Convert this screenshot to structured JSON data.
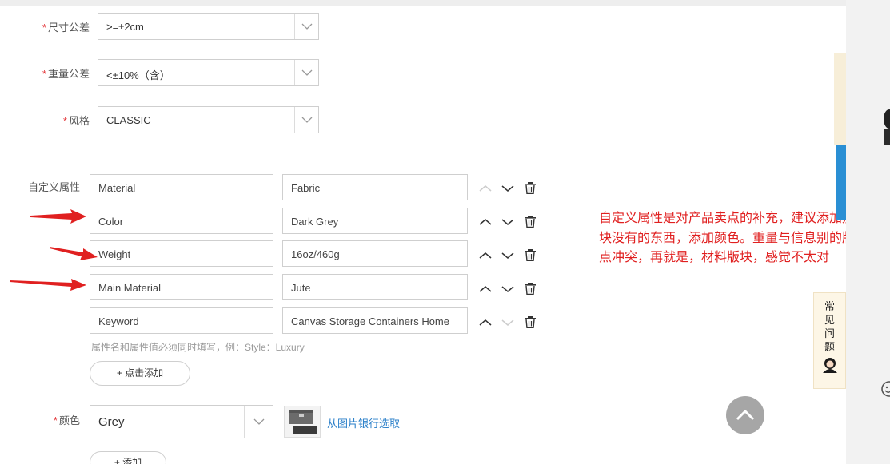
{
  "form": {
    "size_tolerance": {
      "label": "尺寸公差",
      "required": "*",
      "value": ">=±2cm"
    },
    "weight_tolerance": {
      "label": "重量公差",
      "required": "*",
      "value": "<±10%（含）"
    },
    "style": {
      "label": "风格",
      "required": "*",
      "value": "CLASSIC"
    },
    "custom_attrs": {
      "label": "自定义属性",
      "rows": [
        {
          "name": "Material",
          "value": "Fabric"
        },
        {
          "name": "Color",
          "value": "Dark Grey"
        },
        {
          "name": "Weight",
          "value": "16oz/460g"
        },
        {
          "name": "Main Material",
          "value": "Jute"
        },
        {
          "name": "Keyword",
          "value": "Canvas Storage Containers Home"
        }
      ],
      "hint": "属性名和属性值必须同时填写，例：Style：Luxury",
      "add_button": "+ 点击添加"
    },
    "color": {
      "label": "颜色",
      "required": "*",
      "value": "Grey",
      "bank_link": "从图片银行选取",
      "add_button": "+ 添加"
    }
  },
  "annotation": "自定义属性是对产品卖点的补充，建议添加别的版块没有的东西，添加颜色。重量与信息别的版块有点冲突，再就是，材料版块，感觉不太对",
  "faq": {
    "label": "常见问题"
  },
  "colors": {
    "annotation_red": "#e02020",
    "link_blue": "#2a7fc9",
    "required_star": "#e4393c"
  },
  "icons": [
    "chevron-up-icon",
    "chevron-down-icon",
    "trash-icon",
    "arrow-icon",
    "scroll-top-icon",
    "smiley-icon",
    "avatar-icon"
  ]
}
